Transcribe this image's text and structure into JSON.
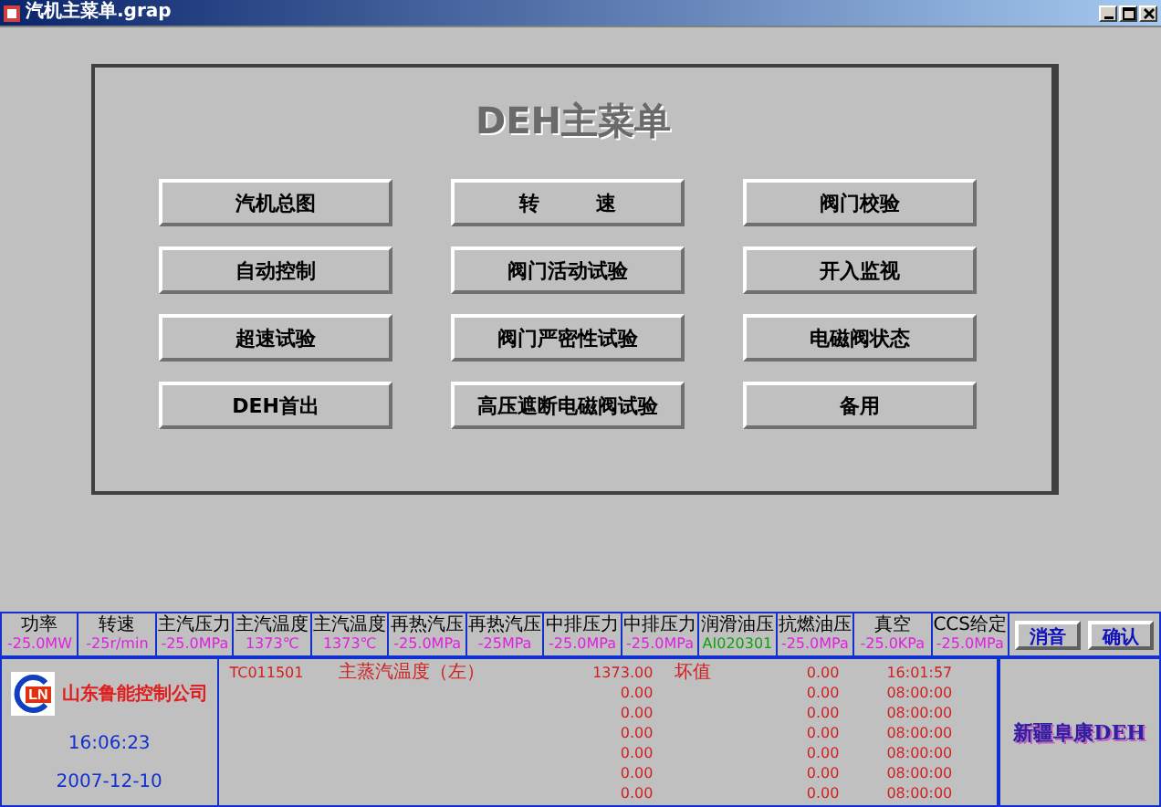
{
  "window": {
    "title": "汽机主菜单.grap"
  },
  "menu": {
    "title": "DEH主菜单",
    "buttons": [
      {
        "label": "汽机总图"
      },
      {
        "label": "转        速"
      },
      {
        "label": "阀门校验"
      },
      {
        "label": "自动控制"
      },
      {
        "label": "阀门活动试验"
      },
      {
        "label": "开入监视"
      },
      {
        "label": "超速试验"
      },
      {
        "label": "阀门严密性试验"
      },
      {
        "label": "电磁阀状态"
      },
      {
        "label": "DEH首出"
      },
      {
        "label": "高压遮断电磁阀试验"
      },
      {
        "label": "备用"
      }
    ]
  },
  "status_panel": {
    "readings": [
      {
        "label": "功率",
        "value": "-25.0MW",
        "color": "#e020e0"
      },
      {
        "label": "转速",
        "value": "-25r/min",
        "color": "#e020e0"
      },
      {
        "label": "主汽压力",
        "value": "-25.0MPa",
        "color": "#e020e0"
      },
      {
        "label": "主汽温度",
        "value": "1373℃",
        "color": "#e020e0"
      },
      {
        "label": "主汽温度",
        "value": "1373℃",
        "color": "#e020e0"
      },
      {
        "label": "再热汽压",
        "value": "-25.0MPa",
        "color": "#e020e0"
      },
      {
        "label": "再热汽压",
        "value": "-25MPa",
        "color": "#e020e0"
      },
      {
        "label": "中排压力",
        "value": "-25.0MPa",
        "color": "#e020e0"
      },
      {
        "label": "中排压力",
        "value": "-25.0MPa",
        "color": "#e020e0"
      },
      {
        "label": "润滑油压",
        "value": "AI020301",
        "color": "#10a010"
      },
      {
        "label": "抗燃油压",
        "value": "-25.0MPa",
        "color": "#e020e0"
      },
      {
        "label": "真空",
        "value": "-25.0KPa",
        "color": "#e020e0"
      },
      {
        "label": "CCS给定",
        "value": "-25.0MPa",
        "color": "#e020e0"
      }
    ],
    "buttons": [
      "消音",
      "确认"
    ],
    "logo_text": "LN",
    "company": "山东鲁能控制公司",
    "time": "16:06:23",
    "date": "2007-12-10",
    "alarms": [
      {
        "tag": "TC011501",
        "name": "主蒸汽温度（左）",
        "value": "1373.00",
        "status": "坏值",
        "value2": "0.00",
        "time": "16:01:57"
      },
      {
        "value": "0.00",
        "value2": "0.00",
        "time": "08:00:00"
      },
      {
        "value": "0.00",
        "value2": "0.00",
        "time": "08:00:00"
      },
      {
        "value": "0.00",
        "value2": "0.00",
        "time": "08:00:00"
      },
      {
        "value": "0.00",
        "value2": "0.00",
        "time": "08:00:00"
      },
      {
        "value": "0.00",
        "value2": "0.00",
        "time": "08:00:00"
      },
      {
        "value": "0.00",
        "value2": "0.00",
        "time": "08:00:00"
      }
    ],
    "site": "新疆阜康DEH"
  }
}
